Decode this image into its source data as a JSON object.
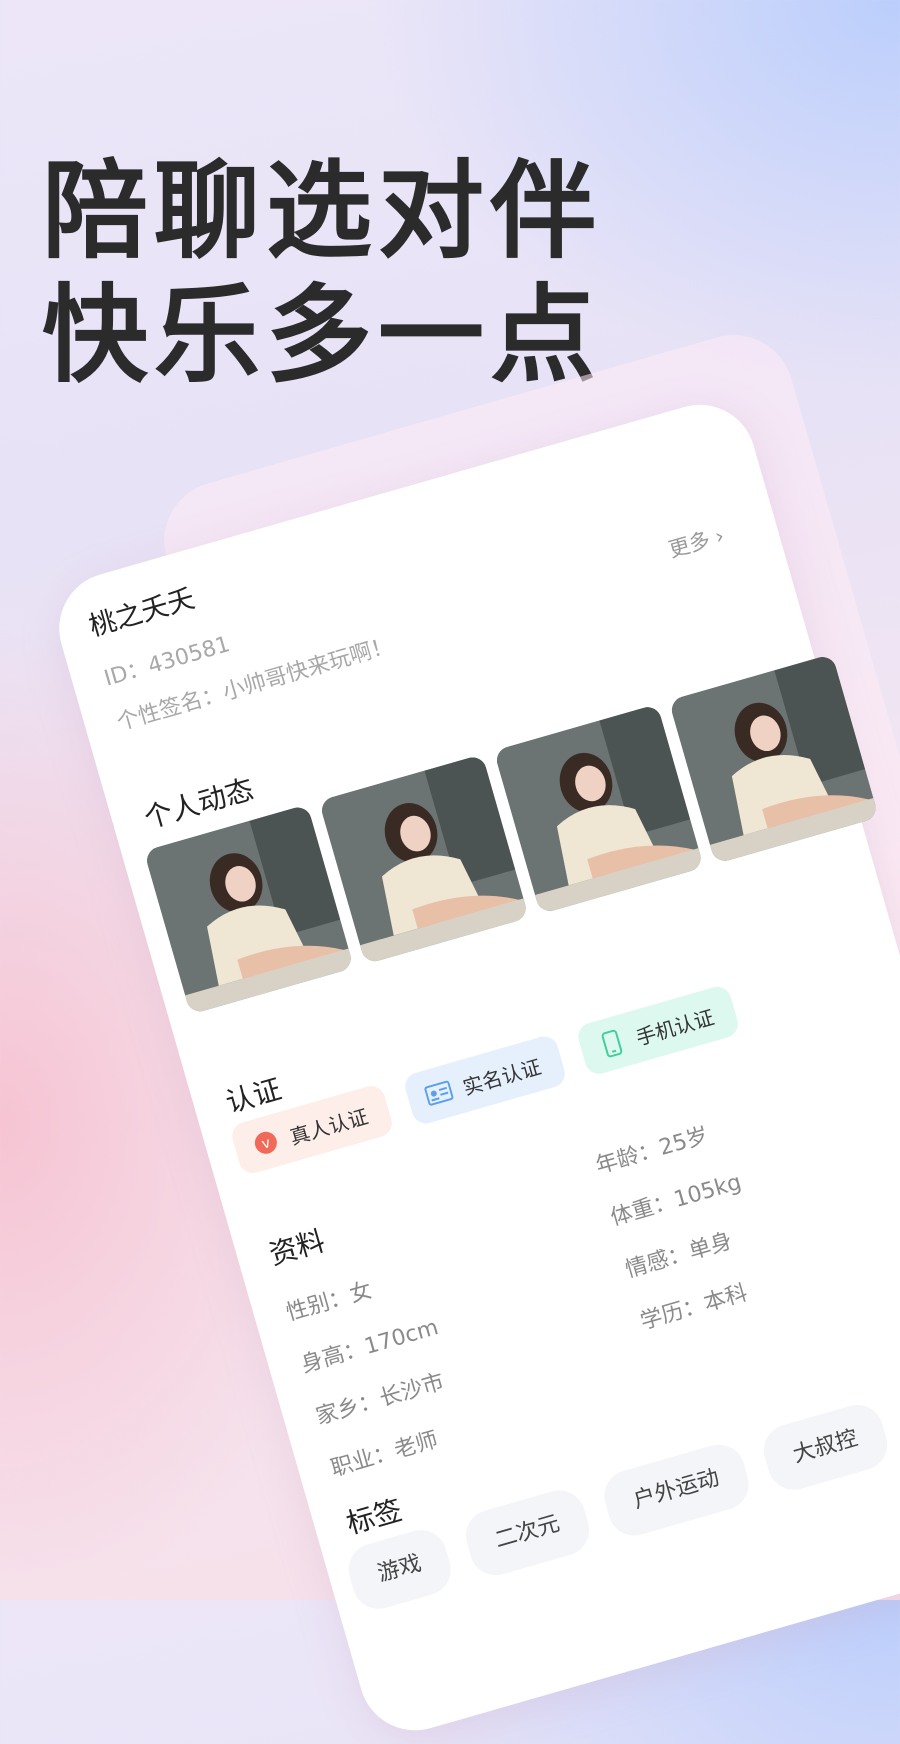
{
  "headline": {
    "line1": "陪聊选对伴",
    "line2": "快乐多一点"
  },
  "profile": {
    "name": "桃之夭夭",
    "id_text": "ID：430581",
    "signature": "个性签名：小帅哥快来玩啊！",
    "more_label": "更多"
  },
  "moments": {
    "title": "个人动态",
    "photos": [
      "photo-1",
      "photo-2",
      "photo-3",
      "photo-4"
    ]
  },
  "certification": {
    "title": "认证",
    "badges": [
      {
        "label": "真人认证",
        "icon": "verified-v-icon",
        "color": "#f06a5a"
      },
      {
        "label": "实名认证",
        "icon": "id-card-icon",
        "color": "#5aa0e8"
      },
      {
        "label": "手机认证",
        "icon": "phone-icon",
        "color": "#3fcf9a"
      }
    ]
  },
  "info": {
    "title": "资料",
    "left": [
      "性别：女",
      "身高：170cm",
      "家乡：长沙市",
      "职业：老师"
    ],
    "right": [
      "年龄：25岁",
      "体重：105kg",
      "情感：单身",
      "学历：本科"
    ]
  },
  "tags": {
    "title": "标签",
    "items": [
      "游戏",
      "二次元",
      "户外运动",
      "大叔控"
    ]
  }
}
